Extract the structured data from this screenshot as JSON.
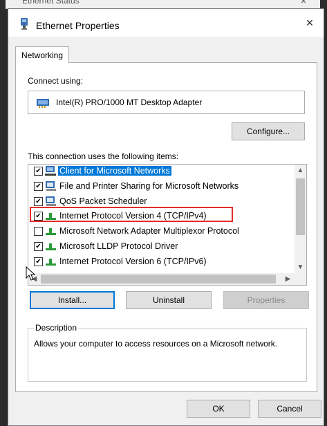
{
  "background_window": {
    "title": "Ethernet Status",
    "close": "×"
  },
  "dialog": {
    "title": "Ethernet Properties",
    "close": "×"
  },
  "tab": {
    "label": "Networking"
  },
  "connect": {
    "label": "Connect using:",
    "adapter": "Intel(R) PRO/1000 MT Desktop Adapter",
    "configure_label": "Configure..."
  },
  "items": {
    "label": "This connection uses the following items:",
    "list": [
      {
        "label": "Client for Microsoft Networks",
        "checked": true,
        "selected": true,
        "icon": "client-network-icon"
      },
      {
        "label": "File and Printer Sharing for Microsoft Networks",
        "checked": true,
        "selected": false,
        "icon": "service-icon"
      },
      {
        "label": "QoS Packet Scheduler",
        "checked": true,
        "selected": false,
        "icon": "service-icon"
      },
      {
        "label": "Internet Protocol Version 4 (TCP/IPv4)",
        "checked": true,
        "selected": false,
        "icon": "protocol-icon",
        "highlighted": true
      },
      {
        "label": "Microsoft Network Adapter Multiplexor Protocol",
        "checked": false,
        "selected": false,
        "icon": "protocol-icon"
      },
      {
        "label": "Microsoft LLDP Protocol Driver",
        "checked": true,
        "selected": false,
        "icon": "protocol-icon"
      },
      {
        "label": "Internet Protocol Version 6 (TCP/IPv6)",
        "checked": true,
        "selected": false,
        "icon": "protocol-icon"
      }
    ]
  },
  "buttons": {
    "install": "Install...",
    "uninstall": "Uninstall",
    "properties": "Properties",
    "ok": "OK",
    "cancel": "Cancel"
  },
  "description": {
    "legend": "Description",
    "text": "Allows your computer to access resources on a Microsoft network."
  },
  "colors": {
    "selection": "#0078d7",
    "highlight_box": "#e32b2b",
    "dialog_bg": "#f0f0f0"
  }
}
